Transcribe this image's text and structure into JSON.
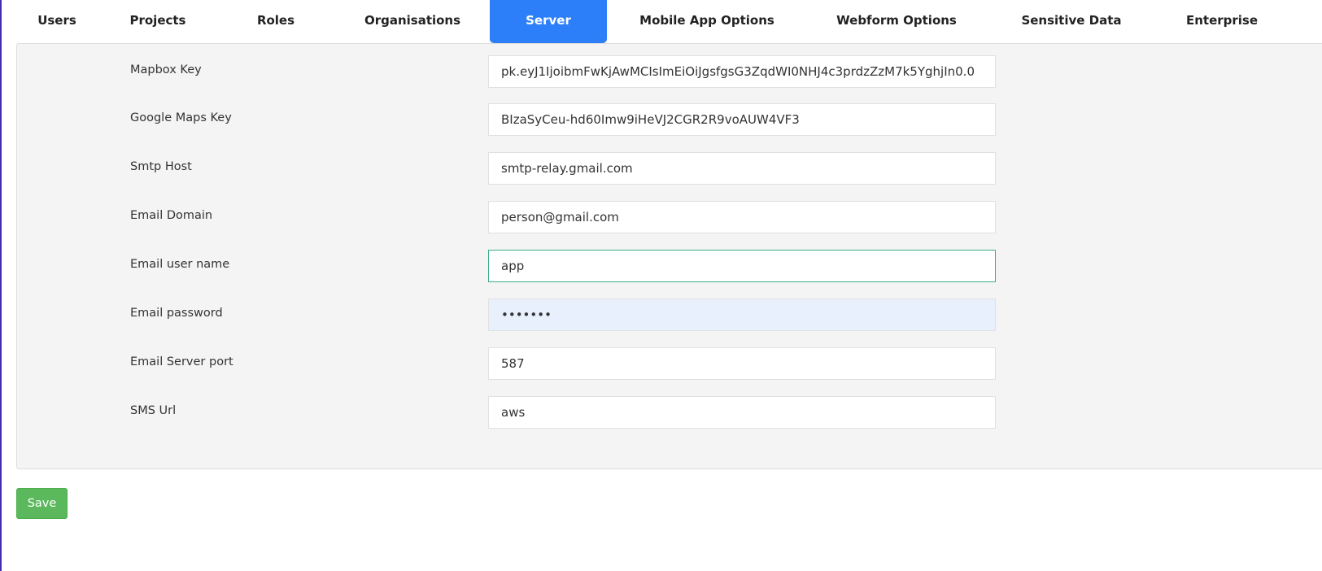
{
  "tabs": [
    {
      "label": "Users"
    },
    {
      "label": "Projects"
    },
    {
      "label": "Roles"
    },
    {
      "label": "Organisations"
    },
    {
      "label": "Server",
      "active": true
    },
    {
      "label": "Mobile App Options"
    },
    {
      "label": "Webform Options"
    },
    {
      "label": "Sensitive Data"
    },
    {
      "label": "Enterprise"
    }
  ],
  "form": {
    "fields": [
      {
        "label": "Mapbox Key",
        "value": "pk.eyJ1IjoibmFwKjAwMCIsImEiOiJgsfgsG3ZqdWI0NHJ4c3prdzZzM7k5YghjIn0.0"
      },
      {
        "label": "Google Maps Key",
        "value": "BIzaSyCeu-hd60Imw9iHeVJ2CGR2R9voAUW4VF3"
      },
      {
        "label": "Smtp Host",
        "value": "smtp-relay.gmail.com"
      },
      {
        "label": "Email Domain",
        "value": "person@gmail.com"
      },
      {
        "label": "Email user name",
        "value": "app"
      },
      {
        "label": "Email password",
        "value": "•••••••"
      },
      {
        "label": "Email Server port",
        "value": "587"
      },
      {
        "label": "SMS Url",
        "value": "aws"
      }
    ]
  },
  "save_label": "Save",
  "colors": {
    "active_tab": "#2d7ff9",
    "save_button": "#5cb85c",
    "focus_border": "#3cae83"
  }
}
